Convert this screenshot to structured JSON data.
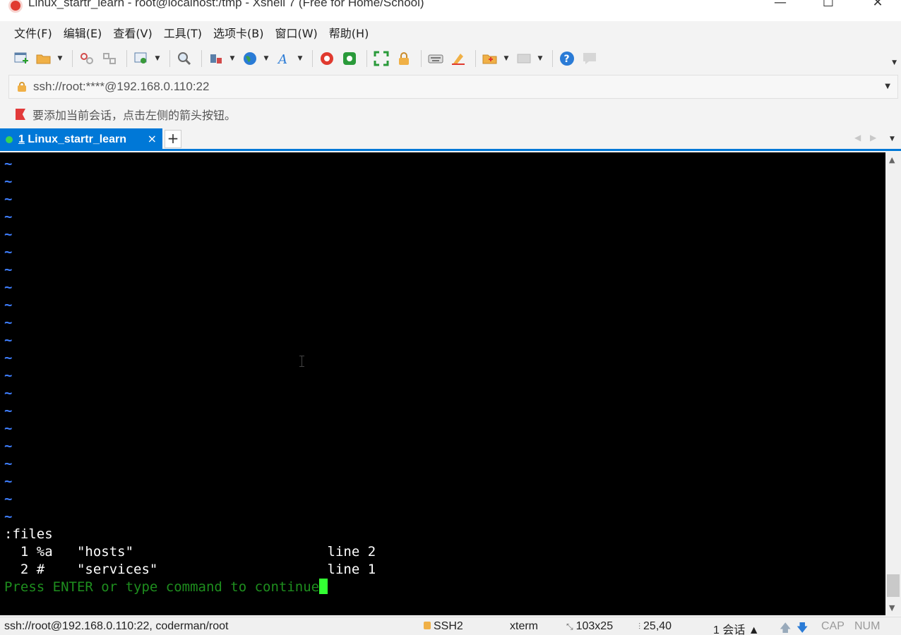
{
  "window": {
    "title": "Linux_startr_learn - root@localhost:/tmp - Xshell 7 (Free for Home/School)",
    "minimize": "—",
    "maximize": "☐",
    "close": "✕"
  },
  "menu": {
    "items": [
      "文件(F)",
      "编辑(E)",
      "查看(V)",
      "工具(T)",
      "选项卡(B)",
      "窗口(W)",
      "帮助(H)"
    ]
  },
  "toolbar": {
    "icons": [
      "new-session-icon",
      "open-folder-icon",
      "reconnect-icon",
      "disconnect-icon",
      "properties-icon",
      "find-icon",
      "transfer-icon",
      "globe-icon",
      "font-icon",
      "xshell-icon",
      "xftp-icon",
      "fullscreen-icon",
      "lock-icon",
      "keyboard-icon",
      "highlight-icon",
      "new-folder-icon",
      "compose-icon",
      "help-icon",
      "chat-icon"
    ],
    "colors": {
      "help": "#2a7bd6",
      "xshell": "#e03a2f",
      "xftp": "#2a9a3a",
      "globe": "#2a7bd6"
    }
  },
  "address": {
    "value": "ssh://root:****@192.168.0.110:22"
  },
  "hint": {
    "text": "要添加当前会话，点击左侧的箭头按钮。"
  },
  "tabs": {
    "active": {
      "number": "1",
      "label": "Linux_startr_learn",
      "close": "×"
    },
    "add": "+"
  },
  "terminal": {
    "tilde": "~",
    "tilde_count": 21,
    "lines": [
      ":files",
      "  1 %a   \"hosts\"                        line 2",
      "  2 #    \"services\"                     line 1"
    ],
    "prompt": "Press ENTER or type command to continue",
    "colors": {
      "background": "#000000",
      "tilde": "#3f7fff",
      "text": "#ffffff",
      "prompt": "#1e8e1e",
      "cursor": "#33ff33"
    }
  },
  "statusbar": {
    "connection": "ssh://root@192.168.0.110:22, coderman/root",
    "protocol": "SSH2",
    "terminal_type": "xterm",
    "size": "103x25",
    "position": "25,40",
    "sessions": "1 会话",
    "caps": "CAP",
    "num": "NUM"
  }
}
